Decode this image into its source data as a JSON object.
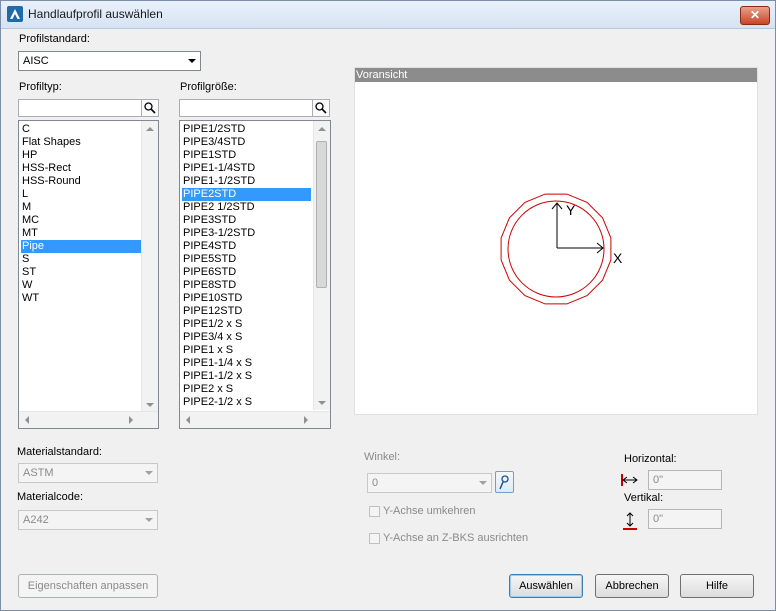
{
  "window": {
    "title": "Handlaufprofil auswählen",
    "close_glyph": "✕"
  },
  "profilstandard": {
    "label": "Profilstandard:",
    "value": "AISC"
  },
  "profiltyp": {
    "label": "Profiltyp:",
    "search_placeholder": "",
    "items": [
      "C",
      "Flat Shapes",
      "HP",
      "HSS-Rect",
      "HSS-Round",
      "L",
      "M",
      "MC",
      "MT",
      "Pipe",
      "S",
      "ST",
      "W",
      "WT"
    ],
    "selected_index": 9
  },
  "profilgroesse": {
    "label": "Profilgröße:",
    "search_placeholder": "",
    "items": [
      "PIPE1/2STD",
      "PIPE3/4STD",
      "PIPE1STD",
      "PIPE1-1/4STD",
      "PIPE1-1/2STD",
      "PIPE2STD",
      "PIPE2 1/2STD",
      "PIPE3STD",
      "PIPE3-1/2STD",
      "PIPE4STD",
      "PIPE5STD",
      "PIPE6STD",
      "PIPE8STD",
      "PIPE10STD",
      "PIPE12STD",
      "PIPE1/2 x S",
      "PIPE3/4 x S",
      "PIPE1 x S",
      "PIPE1-1/4 x S",
      "PIPE1-1/2 x S",
      "PIPE2 x S",
      "PIPE2-1/2 x S"
    ],
    "selected_index": 5
  },
  "preview": {
    "label": "Voransicht",
    "axis_x": "X",
    "axis_y": "Y",
    "outline_color": "#cc0000"
  },
  "material": {
    "standard_label": "Materialstandard:",
    "standard_value": "ASTM",
    "code_label": "Materialcode:",
    "code_value": "A242"
  },
  "winkel": {
    "label": "Winkel:",
    "value": "0"
  },
  "checkboxes": {
    "flip_y": "Y-Achse umkehren",
    "align_z": "Y-Achse an Z-BKS ausrichten"
  },
  "offsets": {
    "horizontal_label": "Horizontal:",
    "horizontal_value": "0\"",
    "vertical_label": "Vertikal:",
    "vertical_value": "0\""
  },
  "buttons": {
    "customize": "Eigenschaften anpassen",
    "select": "Auswählen",
    "cancel": "Abbrechen",
    "help": "Hilfe"
  }
}
